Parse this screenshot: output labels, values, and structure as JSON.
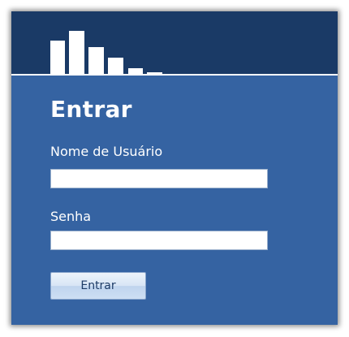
{
  "login": {
    "title": "Entrar",
    "username_label": "Nome de Usuário",
    "username_value": "",
    "password_label": "Senha",
    "password_value": "",
    "submit_label": "Entrar"
  },
  "colors": {
    "header_background": "#1a3a66",
    "panel_background": "#3563a2",
    "text": "#ffffff"
  },
  "logo": {
    "icon": "bar-chart-logo-icon"
  }
}
